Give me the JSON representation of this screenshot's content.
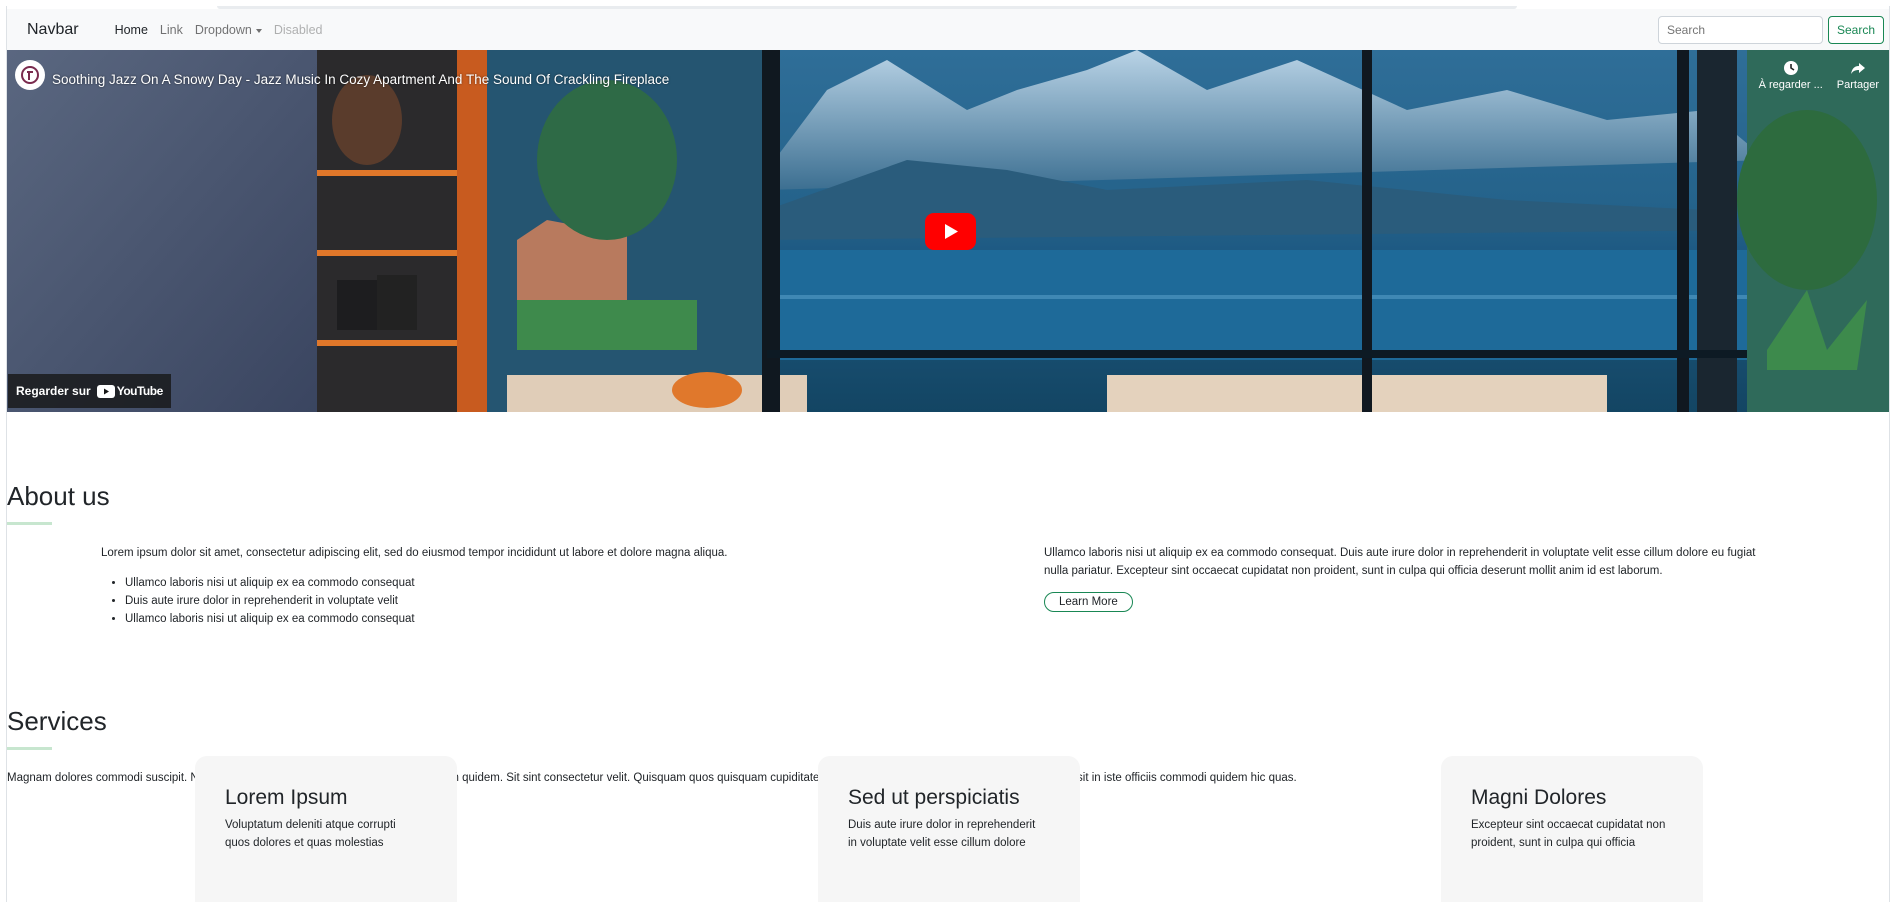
{
  "navbar": {
    "brand": "Navbar",
    "links": [
      "Home",
      "Link",
      "Dropdown",
      "Disabled"
    ],
    "search_placeholder": "Search",
    "search_button": "Search"
  },
  "video": {
    "title": "Soothing Jazz On A Snowy Day - Jazz Music In Cozy Apartment And The Sound Of Crackling Fireplace",
    "watch_later": "À regarder ...",
    "share": "Partager",
    "watch_on": "Regarder sur",
    "youtube": "YouTube"
  },
  "about": {
    "heading": "About us",
    "left_text": "Lorem ipsum dolor sit amet, consectetur adipiscing elit, sed do eiusmod tempor incididunt ut labore et dolore magna aliqua.",
    "items": [
      "Ullamco laboris nisi ut aliquip ex ea commodo consequat",
      "Duis aute irure dolor in reprehenderit in voluptate velit",
      "Ullamco laboris nisi ut aliquip ex ea commodo consequat"
    ],
    "right_text_1": "Ullamco laboris nisi ut aliquip ex ea commodo consequat. Duis aute irure dolor in reprehenderit in voluptate velit esse cillum dolore eu fugiat",
    "right_text_2": "nulla pariatur. Excepteur sint occaecat cupidatat non proident, sunt in culpa qui officia deserunt mollit anim id est laborum.",
    "button": "Learn More"
  },
  "services": {
    "heading": "Services",
    "intro": "Magnam dolores commodi suscipit. Necessitatibus eius consequatur ex aliquid fuga eum quidem. Sit sint consectetur velit. Quisquam quos quisquam cupiditate. Et nemo qui impedit suscipit alias ea. Quia fugiat sit in iste officiis commodi quidem hic quas.",
    "cards": [
      {
        "title": "Lorem Ipsum",
        "line1": "Voluptatum deleniti atque corrupti",
        "line2": "quos dolores et quas molestias"
      },
      {
        "title": "Sed ut perspiciatis",
        "line1": "Duis aute irure dolor in reprehenderit",
        "line2": "in voluptate velit esse cillum dolore"
      },
      {
        "title": "Magni Dolores",
        "line1": "Excepteur sint occaecat cupidatat non",
        "line2": "proident, sunt in culpa qui officia"
      }
    ]
  },
  "colors": {
    "accent": "#198754",
    "navbar_bg": "#f8f9fa",
    "youtube_red": "#ff0000"
  }
}
